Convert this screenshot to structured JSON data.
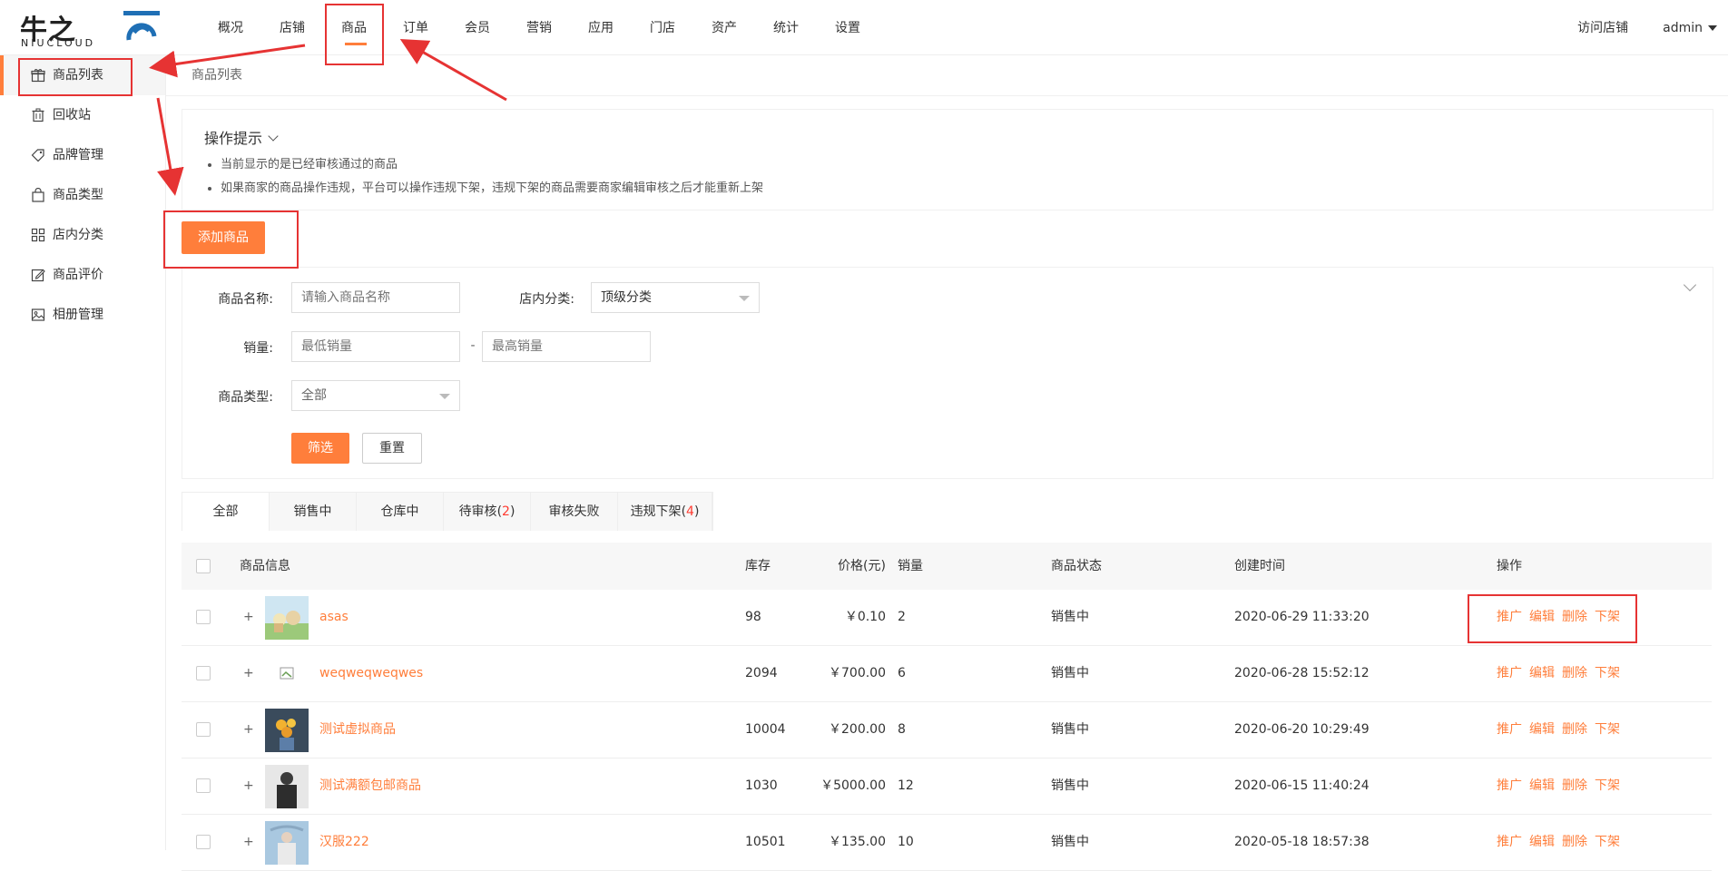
{
  "header": {
    "logo_cn": "牛之",
    "logo_en": "NIUCLOUD",
    "nav": [
      "概况",
      "店铺",
      "商品",
      "订单",
      "会员",
      "营销",
      "应用",
      "门店",
      "资产",
      "统计",
      "设置"
    ],
    "active_nav": "商品",
    "visit_store": "访问店铺",
    "user": "admin"
  },
  "sidebar": {
    "items": [
      {
        "label": "商品列表",
        "icon": "gift-icon"
      },
      {
        "label": "回收站",
        "icon": "trash-icon"
      },
      {
        "label": "品牌管理",
        "icon": "tag-icon"
      },
      {
        "label": "商品类型",
        "icon": "bag-icon"
      },
      {
        "label": "店内分类",
        "icon": "grid-icon"
      },
      {
        "label": "商品评价",
        "icon": "edit-icon"
      },
      {
        "label": "相册管理",
        "icon": "image-icon"
      }
    ]
  },
  "breadcrumb": "商品列表",
  "tips": {
    "title": "操作提示",
    "items": [
      "当前显示的是已经审核通过的商品",
      "如果商家的商品操作违规，平台可以操作违规下架，违规下架的商品需要商家编辑审核之后才能重新上架"
    ]
  },
  "add_button": "添加商品",
  "filter": {
    "name_label": "商品名称:",
    "name_placeholder": "请输入商品名称",
    "category_label": "店内分类:",
    "category_value": "顶级分类",
    "sales_label": "销量:",
    "sales_min_placeholder": "最低销量",
    "sales_sep": "-",
    "sales_max_placeholder": "最高销量",
    "type_label": "商品类型:",
    "type_value": "全部",
    "submit": "筛选",
    "reset": "重置"
  },
  "tabs": [
    {
      "label": "全部",
      "count": ""
    },
    {
      "label": "销售中",
      "count": ""
    },
    {
      "label": "仓库中",
      "count": ""
    },
    {
      "label": "待审核",
      "count": "2"
    },
    {
      "label": "审核失败",
      "count": ""
    },
    {
      "label": "违规下架",
      "count": "4"
    }
  ],
  "table": {
    "headers": [
      "商品信息",
      "价格(元)",
      "库存",
      "销量",
      "商品状态",
      "创建时间",
      "操作"
    ],
    "rows": [
      {
        "name": "asas",
        "price": "￥0.10",
        "stock": "98",
        "sales": "2",
        "status": "销售中",
        "created": "2020-06-29 11:33:20"
      },
      {
        "name": "weqweqweqwes",
        "price": "￥700.00",
        "stock": "2094",
        "sales": "6",
        "status": "销售中",
        "created": "2020-06-28 15:52:12"
      },
      {
        "name": "测试虚拟商品",
        "price": "￥200.00",
        "stock": "10004",
        "sales": "8",
        "status": "销售中",
        "created": "2020-06-20 10:29:49"
      },
      {
        "name": "测试满额包邮商品",
        "price": "￥5000.00",
        "stock": "1030",
        "sales": "12",
        "status": "销售中",
        "created": "2020-06-15 11:40:24"
      },
      {
        "name": "汉服222",
        "price": "￥135.00",
        "stock": "10501",
        "sales": "10",
        "status": "销售中",
        "created": "2020-05-18 18:57:38"
      }
    ],
    "actions": [
      "推广",
      "编辑",
      "删除",
      "下架"
    ],
    "expand_symbol": "+"
  },
  "colors": {
    "accent": "#ff7e3b",
    "annotation": "#e63333"
  }
}
